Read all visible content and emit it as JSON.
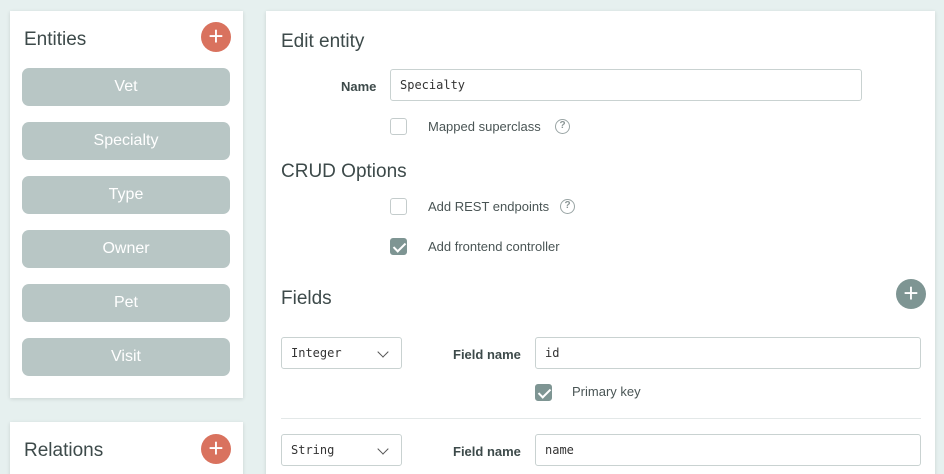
{
  "sidebar": {
    "entities_title": "Entities",
    "add_entity_symbol": "+",
    "entities": [
      {
        "label": "Vet"
      },
      {
        "label": "Specialty"
      },
      {
        "label": "Type"
      },
      {
        "label": "Owner"
      },
      {
        "label": "Pet"
      },
      {
        "label": "Visit"
      }
    ],
    "relations_title": "Relations",
    "add_relation_symbol": "+"
  },
  "edit": {
    "title": "Edit entity",
    "name_label": "Name",
    "name_value": "Specialty",
    "mapped_superclass_label": "Mapped superclass",
    "mapped_superclass_checked": false,
    "help_symbol": "?"
  },
  "crud": {
    "title": "CRUD Options",
    "rest_label": "Add REST endpoints",
    "rest_checked": false,
    "frontend_label": "Add frontend controller",
    "frontend_checked": true
  },
  "fields": {
    "title": "Fields",
    "add_field_symbol": "+",
    "field_name_label": "Field name",
    "primary_key_label": "Primary key",
    "items": [
      {
        "type": "Integer",
        "name": "id",
        "primary_key": true
      },
      {
        "type": "String",
        "name": "name"
      }
    ]
  },
  "colors": {
    "accent_orange": "#d9725e",
    "accent_gray": "#7e9593",
    "entity_button": "#b8c6c5",
    "background": "#e6f0ef"
  }
}
